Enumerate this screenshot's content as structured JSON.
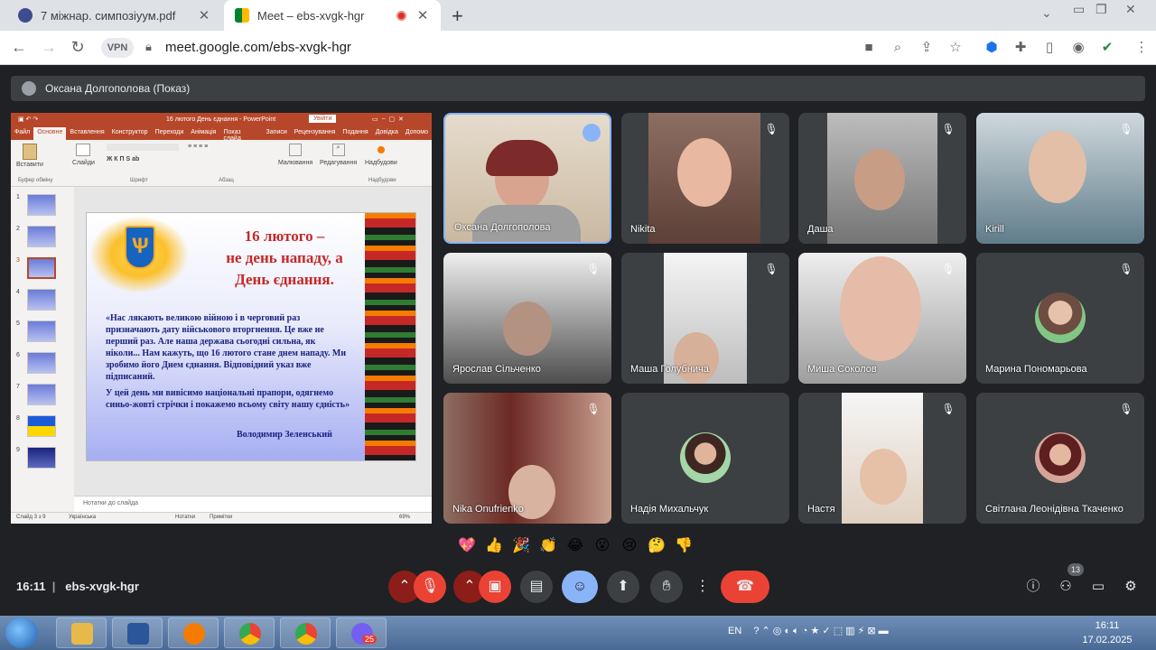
{
  "browser": {
    "tabs": [
      {
        "title": "7 міжнар. симпозіуум.pdf",
        "active": false
      },
      {
        "title": "Meet – ebs-xvgk-hgr",
        "active": true
      }
    ],
    "url": "meet.google.com/ebs-xvgk-hgr",
    "vpn_label": "VPN"
  },
  "meet": {
    "presenter_label": "Оксана Долгополова (Показ)",
    "meeting_time": "16:11",
    "meeting_code": "ebs-xvgk-hgr",
    "participant_count": "13",
    "reactions": [
      "💖",
      "👍",
      "🎉",
      "👏",
      "😂",
      "😮",
      "😢",
      "🤔",
      "👎"
    ],
    "participants": [
      {
        "name": "Оксана Долгополова",
        "speaking": true
      },
      {
        "name": "Nikita"
      },
      {
        "name": "Даша"
      },
      {
        "name": "Kirill"
      },
      {
        "name": "Ярослав Сільченко"
      },
      {
        "name": "Маша Голубнича"
      },
      {
        "name": "Миша Соколов"
      },
      {
        "name": "Марина Пономарьова"
      },
      {
        "name": "Nika Onufrienko"
      },
      {
        "name": "Надія Михальчук"
      },
      {
        "name": "Настя"
      },
      {
        "name": "Світлана Леонідівна Ткаченко"
      }
    ]
  },
  "presentation": {
    "window_title": "16 лютого День єднання - PowerPoint",
    "login_label": "Увійти",
    "ribbon_tabs": [
      "Файл",
      "Основне",
      "Вставлення",
      "Конструктор",
      "Переходи",
      "Анімація",
      "Показ слайд",
      "Записи",
      "Рецензування",
      "Подання",
      "Довідка",
      "Допомо"
    ],
    "ribbon_groups": {
      "paste": "Вставити",
      "slides": "Слайди",
      "draw": "Малювання",
      "editing": "Редагування",
      "addins": "Надбудови",
      "clipboard": "Буфер обміну",
      "font": "Шрифт",
      "paragraph": "Абзац",
      "addins_group": "Надбудови"
    },
    "thumb_numbers": [
      "1",
      "2",
      "3",
      "4",
      "5",
      "6",
      "7",
      "8",
      "9"
    ],
    "slide": {
      "heading_line1": "16 лютого –",
      "heading_line2": "не день нападу, а",
      "heading_line3": "День єднання.",
      "quote": "«Нас лякають великою війною і в черговий раз призначають дату військового вторгнення. Це вже не перший раз. Але наша держава сьогодні сильна, як ніколи... Нам кажуть, що 16 лютого стане днем нападу. Ми зробимо його Днем єднання. Відповідний указ вже підписаний.",
      "quote2": "У цей день ми вивісимо національні прапори, одягнемо синьо-жовті стрічки і покажемо всьому світу нашу єдність»",
      "author": "Володимир Зеленський"
    },
    "notes_label": "Нотатки до слайда",
    "status_slide": "Слайд 3 з 9",
    "status_lang": "Українська",
    "status_notes": "Нотатки",
    "status_comments": "Примітки",
    "status_zoom": "69%"
  },
  "taskbar": {
    "lang": "EN",
    "time": "16:11",
    "date": "17.02.2025",
    "viber_badge": "25"
  },
  "colors": {
    "meet_bg": "#202124",
    "tile_bg": "#3c4043",
    "end_call": "#ea4335",
    "accent_blue": "#8ab4f8",
    "powerpoint": "#b7472a"
  }
}
